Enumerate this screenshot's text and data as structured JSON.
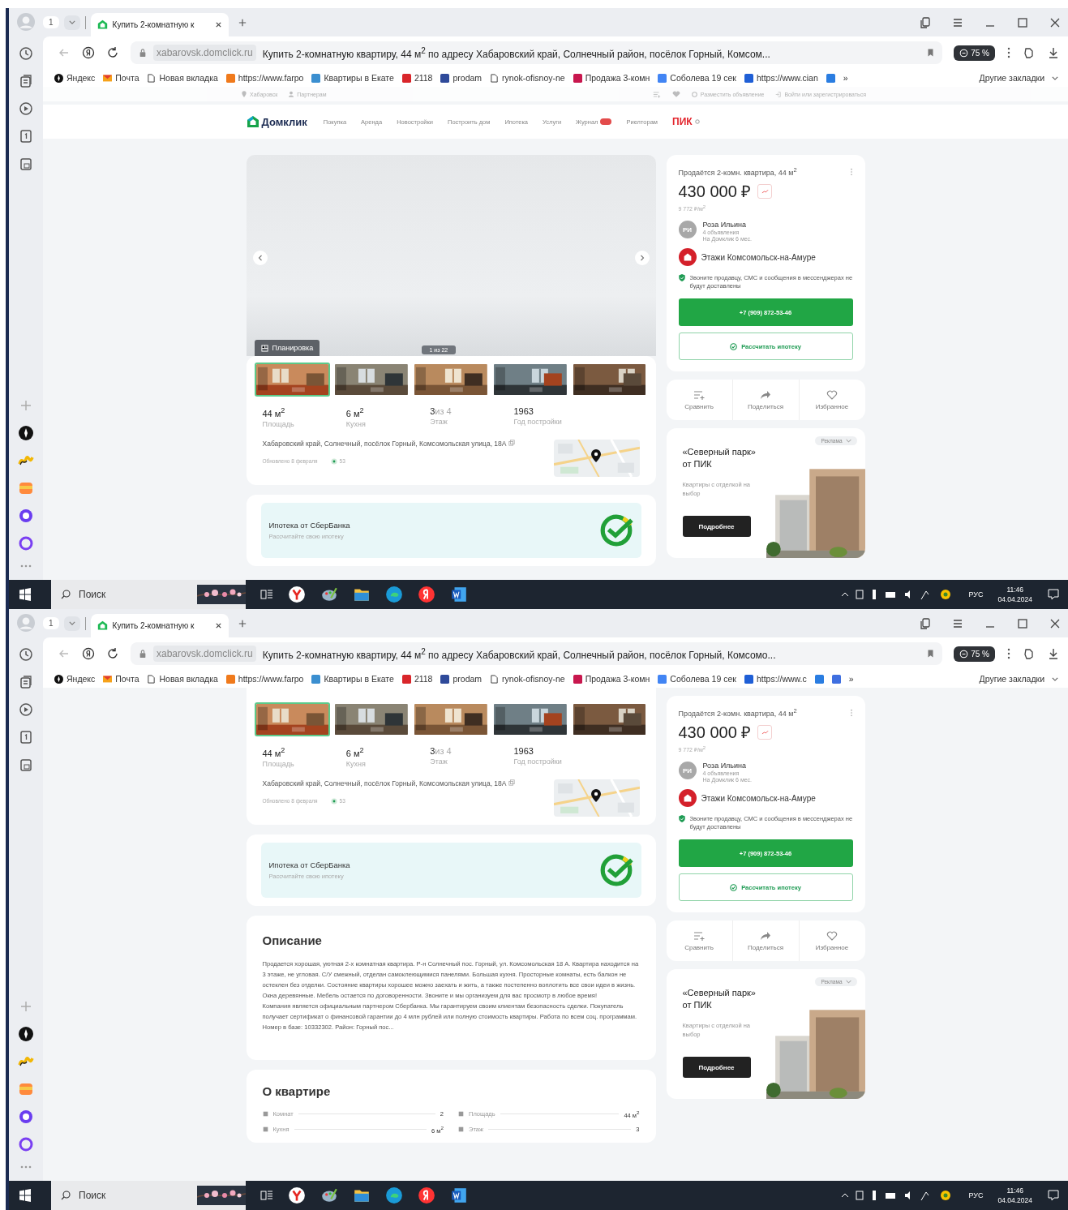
{
  "screens": [
    {
      "tab": {
        "count": "1",
        "title": "Купить 2-комнатную к"
      },
      "address": {
        "domain": "xabarovsk.domclick.ru",
        "title": "Купить 2-комнатную квартиру, 44 м$^{2}$ по адресу Хабаровский край, Солнечный район, посёлок Горный, Комсом...",
        "zoom": "75 %"
      },
      "bookmarks": [
        {
          "kind": "yandex",
          "label": "Яндекс"
        },
        {
          "kind": "mail",
          "label": "Почта"
        },
        {
          "kind": "page",
          "label": "Новая вкладка"
        },
        {
          "kind": "site",
          "color": "#f07a1c",
          "label": "https://www.farpo"
        },
        {
          "kind": "site",
          "color": "#3b8fd0",
          "label": "Квартиры в Екате"
        },
        {
          "kind": "site",
          "color": "#d9262b",
          "label": "2118"
        },
        {
          "kind": "site",
          "color": "#2f4a9a",
          "label": "prodam"
        },
        {
          "kind": "page",
          "label": "rynok-ofisnoy-ne"
        },
        {
          "kind": "site",
          "color": "#c8174e",
          "label": "Продажа 3-комн"
        },
        {
          "kind": "site",
          "color": "#4285f4",
          "label": "Соболева 19 сек"
        },
        {
          "kind": "site",
          "color": "#1f5fd6",
          "label": "https://www.cian"
        },
        {
          "kind": "site",
          "color": "#2a7de1"
        }
      ],
      "more_bookmarks": "»",
      "other_bookmarks": "Другие закладки",
      "site_topbar": {
        "city": "Хабаровск",
        "partners": "Партнерам",
        "post": "Разместить объявление",
        "login": "Войти или зарегистрироваться"
      },
      "site_header": {
        "logo": "Домклик",
        "nav": [
          {
            "label": "Покупка",
            "badge": false
          },
          {
            "label": "Аренда",
            "badge": false
          },
          {
            "label": "Новостройки",
            "badge": false
          },
          {
            "label": "Построить дом",
            "badge": false
          },
          {
            "label": "Ипотека",
            "badge": false
          },
          {
            "label": "Услуги",
            "badge": false
          },
          {
            "label": "Журнал",
            "badge": true
          },
          {
            "label": "Риелторам",
            "badge": false
          }
        ],
        "brand": "ПИК"
      },
      "gallery": {
        "plan": "Планировка",
        "counter": "1 из 22"
      },
      "thumbnails": [
        {
          "selected": true
        },
        {
          "selected": false
        },
        {
          "selected": false
        },
        {
          "selected": false
        },
        {
          "selected": false
        }
      ],
      "facts": [
        {
          "value": "44 м$^{2}$",
          "label": "Площадь"
        },
        {
          "value": "6 м$^{2}$",
          "label": "Кухня"
        },
        {
          "value": "3",
          "suffix": "из 4",
          "label": "Этаж"
        },
        {
          "value": "1963",
          "label": "Год постройки"
        }
      ],
      "address_text": "Хабаровский край, Солнечный, посёлок Горный, Комсомольская улица, 18А",
      "updated": "Обновлено 8 февраля",
      "views": "53",
      "mortgage": {
        "title": "Ипотека от СберБанка",
        "subtitle": "Рассчитайте свою ипотеку"
      },
      "offer": {
        "title": "Продаётся 2-комн. квартира, 44 м$^{2}$",
        "price": "430 000 ₽",
        "per_meter": "9 772 ₽/м$^{2}$",
        "initials": "РИ",
        "seller": "Роза Ильина",
        "ads": "4 объявления",
        "since": "На Домклик 6 мес.",
        "agency": "Этажи Комсомольск-на-Амуре",
        "notice": "Звоните продавцу, СМС и сообщения в мессенджерах не будут доставлены",
        "phone": "+7 (909) 872-53-46",
        "calc": "Рассчитать ипотеку"
      },
      "actions": [
        {
          "kind": "compare",
          "label": "Сравнить"
        },
        {
          "kind": "share",
          "label": "Поделиться"
        },
        {
          "kind": "favorite",
          "label": "Избранное"
        }
      ],
      "ad": {
        "tag": "Реклама",
        "title": "«Северный парк» от ПИК",
        "text": "Квартиры с отделкой на выбор",
        "button": "Подробнее"
      },
      "taskbar": {
        "search": "Поиск",
        "lang": "РУС",
        "time": "11:46",
        "date": "04.04.2024"
      }
    },
    {
      "tab": {
        "count": "1",
        "title": "Купить 2-комнатную к"
      },
      "address": {
        "domain": "xabarovsk.domclick.ru",
        "title": "Купить 2-комнатную квартиру, 44 м$^{2}$ по адресу Хабаровский край, Солнечный район, посёлок Горный, Комсомо...",
        "zoom": "75 %"
      },
      "bookmarks": [
        {
          "kind": "yandex",
          "label": "Яндекс"
        },
        {
          "kind": "mail",
          "label": "Почта"
        },
        {
          "kind": "page",
          "label": "Новая вкладка"
        },
        {
          "kind": "site",
          "color": "#f07a1c",
          "label": "https://www.farpo"
        },
        {
          "kind": "site",
          "color": "#3b8fd0",
          "label": "Квартиры в Екате"
        },
        {
          "kind": "site",
          "color": "#d9262b",
          "label": "2118"
        },
        {
          "kind": "site",
          "color": "#2f4a9a",
          "label": "prodam"
        },
        {
          "kind": "page",
          "label": "rynok-ofisnoy-ne"
        },
        {
          "kind": "site",
          "color": "#c8174e",
          "label": "Продажа 3-комн"
        },
        {
          "kind": "site",
          "color": "#4285f4",
          "label": "Соболева 19 сек"
        },
        {
          "kind": "site",
          "color": "#1f5fd6",
          "label": "https://www.c"
        },
        {
          "kind": "site",
          "color": "#2a7de1"
        },
        {
          "kind": "site",
          "color": "#3f6fe0"
        }
      ],
      "more_bookmarks": "»",
      "other_bookmarks": "Другие закладки",
      "thumbnails": [
        {
          "selected": true
        },
        {
          "selected": false
        },
        {
          "selected": false
        },
        {
          "selected": false
        },
        {
          "selected": false
        }
      ],
      "facts": [
        {
          "value": "44 м$^{2}$",
          "label": "Площадь"
        },
        {
          "value": "6 м$^{2}$",
          "label": "Кухня"
        },
        {
          "value": "3",
          "suffix": "из 4",
          "label": "Этаж"
        },
        {
          "value": "1963",
          "label": "Год постройки"
        }
      ],
      "address_text": "Хабаровский край, Солнечный, посёлок Горный, Комсомольская улица, 18А",
      "updated": "Обновлено 8 февраля",
      "views": "53",
      "mortgage": {
        "title": "Ипотека от СберБанка",
        "subtitle": "Рассчитайте свою ипотеку"
      },
      "description": {
        "title": "Описание",
        "paragraphs": [
          "Продается хорошая, уютная 2-х комнатная квартира. Р-н Солнечный пос. Горный, ул. Комсомольская 18 А. Квартира находится на 3 этаже, не угловая. С/У смежный, отделан самоклеющимися панелями. Большая кухня. Просторные комнаты, есть балкон не остеклен без отделки. Состояние квартиры хорошее можно заехать и жить, а также постепенно воплотить все свои идеи в жизнь. Окна деревянные. Мебель остается по договоренности. Звоните и мы организуем для вас просмотр в любое время!",
          "Компания является официальным партнером Сбербанка. Мы гарантируем своим клиентам безопасность сделки. Покупатель получает сертификат о финансовой гарантии до 4 млн рублей или полную стоимость квартиры. Работа по всем соц. программам. Номер в базе: 10332302. Район: Горный пос..."
        ]
      },
      "about": {
        "title": "О квартире",
        "rows": [
          {
            "label": "Комнат",
            "value": "2"
          },
          {
            "label": "Площадь",
            "value": "44 м$^{2}$"
          },
          {
            "label": "Кухня",
            "value": "6 м$^{2}$"
          },
          {
            "label": "Этаж",
            "value": "3"
          }
        ]
      },
      "offer": {
        "title": "Продаётся 2-комн. квартира, 44 м$^{2}$",
        "price": "430 000 ₽",
        "per_meter": "9 772 ₽/м$^{2}$",
        "initials": "РИ",
        "seller": "Роза Ильина",
        "ads": "4 объявления",
        "since": "На Домклик 6 мес.",
        "agency": "Этажи Комсомольск-на-Амуре",
        "notice": "Звоните продавцу, СМС и сообщения в мессенджерах не будут доставлены",
        "phone": "+7 (909) 872-53-46",
        "calc": "Рассчитать ипотеку"
      },
      "actions": [
        {
          "kind": "compare",
          "label": "Сравнить"
        },
        {
          "kind": "share",
          "label": "Поделиться"
        },
        {
          "kind": "favorite",
          "label": "Избранное"
        }
      ],
      "ad": {
        "tag": "Реклама",
        "title": "«Северный парк» от ПИК",
        "text": "Квартиры с отделкой на выбор",
        "button": "Подробнее"
      },
      "taskbar": {
        "search": "Поиск",
        "lang": "РУС",
        "time": "11:46",
        "date": "04.04.2024"
      }
    }
  ]
}
